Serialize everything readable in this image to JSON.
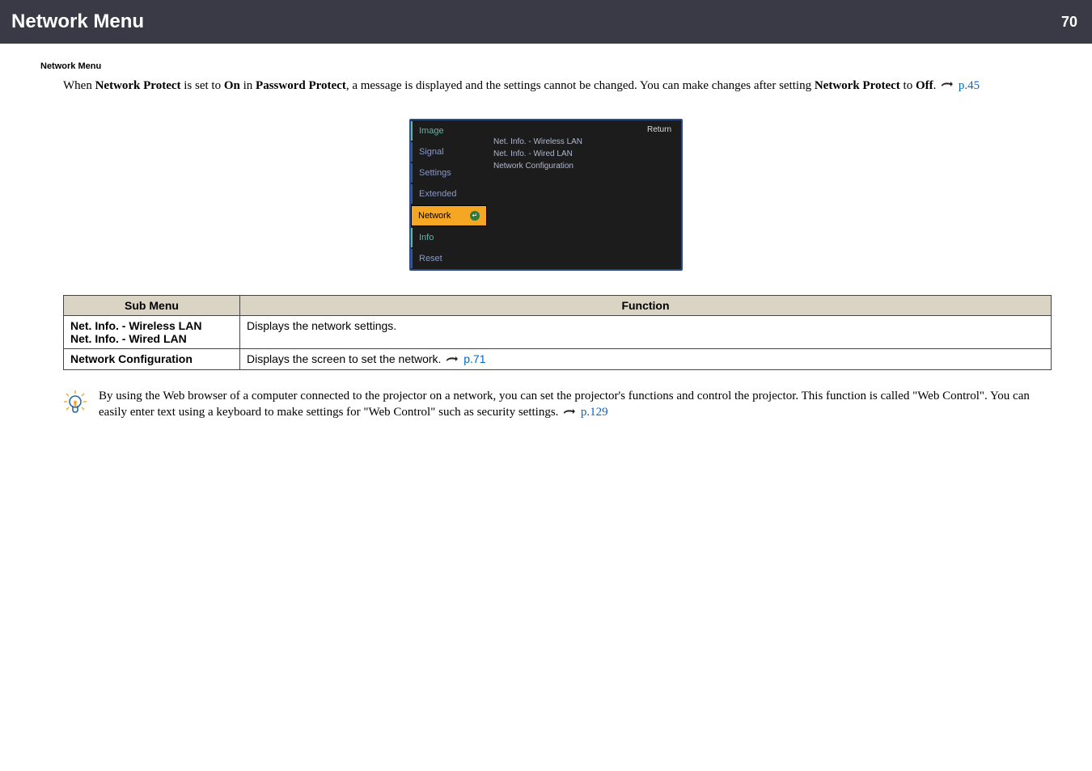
{
  "header": {
    "title": "Network Menu",
    "page_number": "70"
  },
  "section_label": "Network Menu",
  "intro": {
    "part1": "When ",
    "bold1": "Network Protect",
    "part2": " is set to ",
    "bold2": "On",
    "part3": " in ",
    "bold3": "Password Protect",
    "part4": ", a message is displayed and the settings cannot be changed. You can make changes after setting ",
    "bold4": "Network Protect",
    "part5": " to ",
    "bold5": "Off",
    "part6": ". ",
    "link": "p.45"
  },
  "osd": {
    "left": {
      "image": "Image",
      "signal": "Signal",
      "settings": "Settings",
      "extended": "Extended",
      "network": "Network",
      "info": "Info",
      "reset": "Reset"
    },
    "right": {
      "return": "Return",
      "l1": "Net. Info. - Wireless LAN",
      "l2": "Net. Info. - Wired LAN",
      "l3": "Network Configuration"
    }
  },
  "table": {
    "h1": "Sub Menu",
    "h2": "Function",
    "r1c1a": "Net. Info. - Wireless LAN",
    "r1c1b": "Net. Info. - Wired LAN",
    "r1c2": "Displays the network settings.",
    "r2c1": "Network Configuration",
    "r2c2": "Displays the screen to set the network. ",
    "r2link": "p.71"
  },
  "tip": {
    "text1": "By using the Web browser of a computer connected to the projector on a network, you can set the projector's functions and control the projector. This function is called \"Web Control\". You can easily enter text using a keyboard to make settings for \"Web Control\" such as security settings. ",
    "link": "p.129"
  }
}
